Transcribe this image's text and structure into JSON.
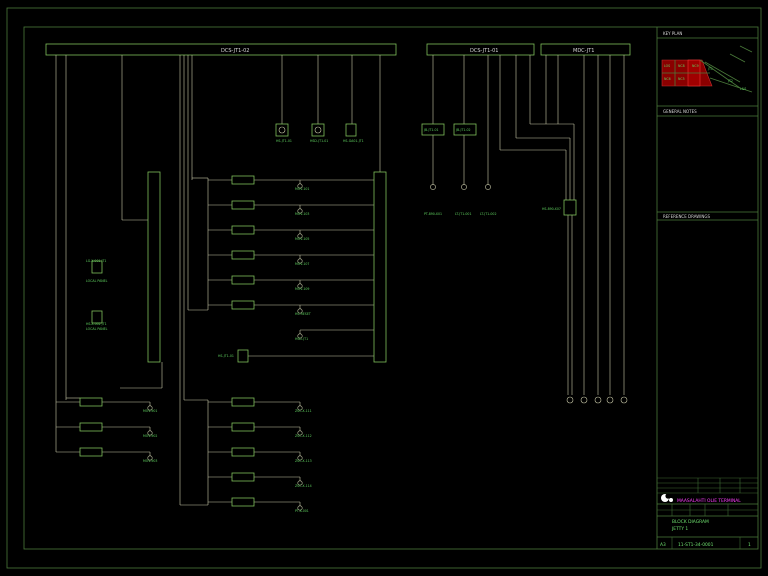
{
  "buses": {
    "dcs_jt1_02": "DCS-JT1-02",
    "dcs_jt1_01": "DCS-JT1-01",
    "mdc_jt1": "MDC-JT1"
  },
  "title_block": {
    "key_plan": "KEY PLAN",
    "general_notes": "GENERAL NOTES",
    "reference_drawings": "REFERENCE DRAWINGS",
    "company": "MAASALAHTI OLIE TERMINAL",
    "drawing_title": "BLOCK DIAGRAM",
    "drawing_subtitle": "JETTY 1",
    "size": "A3",
    "drawing_number": "11-ST1-34-0001",
    "revision": "1"
  }
}
